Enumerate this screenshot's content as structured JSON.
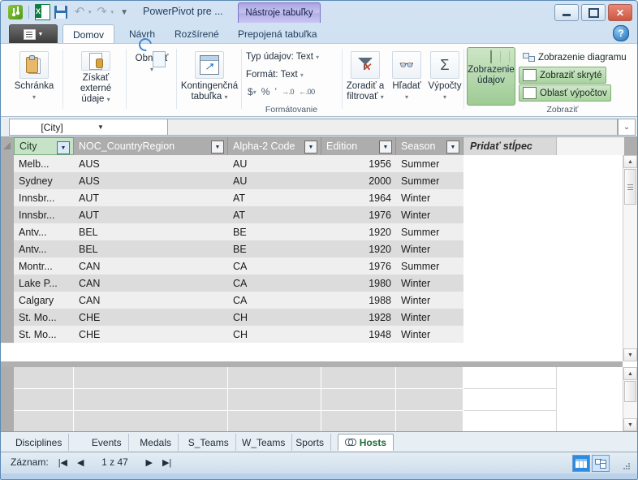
{
  "window": {
    "document_title": "PowerPivot pre ...",
    "context_tab": "Nástroje tabuľky",
    "minimize": "–",
    "restore": "❐",
    "close": "✕",
    "help": "?"
  },
  "quick_access": {
    "powerpivot": "powerpivot-icon",
    "excel": "excel-icon",
    "save": "save-icon",
    "undo": "↶",
    "undo_arrow": "▾",
    "redo": "↷",
    "redo_arrow": "▾",
    "customize": "▼"
  },
  "ribbon_tabs": {
    "file_menu": "file-menu",
    "items": [
      {
        "label": "Domov",
        "active": true
      },
      {
        "label": "Návrh",
        "active": false
      },
      {
        "label": "Rozšírené",
        "active": false
      },
      {
        "label": "Prepojená tabuľka",
        "active": false
      }
    ]
  },
  "ribbon": {
    "clipboard": {
      "label": "Schránka",
      "dropdown": "▾"
    },
    "external": {
      "label": "Získať externé údaje",
      "dropdown": "▾"
    },
    "refresh": {
      "label": "Obnoviť",
      "dropdown": "▾"
    },
    "pivot": {
      "label": "Kontingenčná tabuľka",
      "dropdown": "▾"
    },
    "formatting": {
      "group_label": "Formátovanie",
      "data_type": "Typ údajov: Text",
      "data_type_dd": "▾",
      "format": "Formát: Text",
      "format_dd": "▾",
      "currency": "$",
      "currency_dd": "▾",
      "percent": "%",
      "comma": "ʼ",
      "inc_decimal": "→.0",
      "dec_decimal": "←.00"
    },
    "sort_filter": {
      "label": "Zoradiť a filtrovať",
      "dropdown": "▾"
    },
    "find": {
      "label": "Hľadať",
      "dropdown": "▾"
    },
    "calculations": {
      "label": "Výpočty",
      "dropdown": "▾"
    },
    "view": {
      "group_label": "Zobraziť",
      "data_view": "Zobrazenie údajov",
      "diagram_view": "Zobrazenie diagramu",
      "show_hidden": "Zobraziť skryté",
      "calc_area": "Oblasť výpočtov"
    }
  },
  "formula_bar": {
    "name_box_value": "[City]",
    "name_box_arrow": "▼",
    "formula_value": "",
    "expand_arrow": "⌄"
  },
  "grid": {
    "columns": [
      {
        "name": "City",
        "selected": true,
        "filter": "▼",
        "align": "left"
      },
      {
        "name": "NOC_CountryRegion",
        "selected": false,
        "filter": "▼",
        "align": "left"
      },
      {
        "name": "Alpha-2 Code",
        "selected": false,
        "filter": "▼",
        "align": "left"
      },
      {
        "name": "Edition",
        "selected": false,
        "filter": "▼",
        "align": "right"
      },
      {
        "name": "Season",
        "selected": false,
        "filter": "▼",
        "align": "left"
      }
    ],
    "add_column": "Pridať stĺpec",
    "rows": [
      [
        "Melb...",
        "AUS",
        "AU",
        "1956",
        "Summer"
      ],
      [
        "Sydney",
        "AUS",
        "AU",
        "2000",
        "Summer"
      ],
      [
        "Innsbr...",
        "AUT",
        "AT",
        "1964",
        "Winter"
      ],
      [
        "Innsbr...",
        "AUT",
        "AT",
        "1976",
        "Winter"
      ],
      [
        "Antv...",
        "BEL",
        "BE",
        "1920",
        "Summer"
      ],
      [
        "Antv...",
        "BEL",
        "BE",
        "1920",
        "Winter"
      ],
      [
        "Montr...",
        "CAN",
        "CA",
        "1976",
        "Summer"
      ],
      [
        "Lake P...",
        "CAN",
        "CA",
        "1980",
        "Winter"
      ],
      [
        "Calgary",
        "CAN",
        "CA",
        "1988",
        "Winter"
      ],
      [
        "St. Mo...",
        "CHE",
        "CH",
        "1928",
        "Winter"
      ],
      [
        "St. Mo...",
        "CHE",
        "CH",
        "1948",
        "Winter"
      ]
    ]
  },
  "sheet_tabs": [
    {
      "label": "Disciplines",
      "active": false,
      "icon": ""
    },
    {
      "label": "Events",
      "active": false,
      "icon": ""
    },
    {
      "label": "Medals",
      "active": false,
      "icon": ""
    },
    {
      "label": "S_Teams",
      "active": false,
      "icon": ""
    },
    {
      "label": "W_Teams",
      "active": false,
      "icon": ""
    },
    {
      "label": "Sports",
      "active": false,
      "icon": ""
    },
    {
      "label": "Hosts",
      "active": true,
      "icon": "link-icon"
    }
  ],
  "status_bar": {
    "record_label": "Záznam:",
    "first": "|◀",
    "prev": "◀",
    "position": "1 z 47",
    "next": "▶",
    "last": "▶|",
    "view_data": "data-view-button",
    "view_diagram": "diagram-view-button"
  },
  "colors": {
    "accent_green": "#9ecb94",
    "context_tab": "#b3aee7",
    "header_grey": "#adadad",
    "selected_col": "#c6e3c8"
  }
}
